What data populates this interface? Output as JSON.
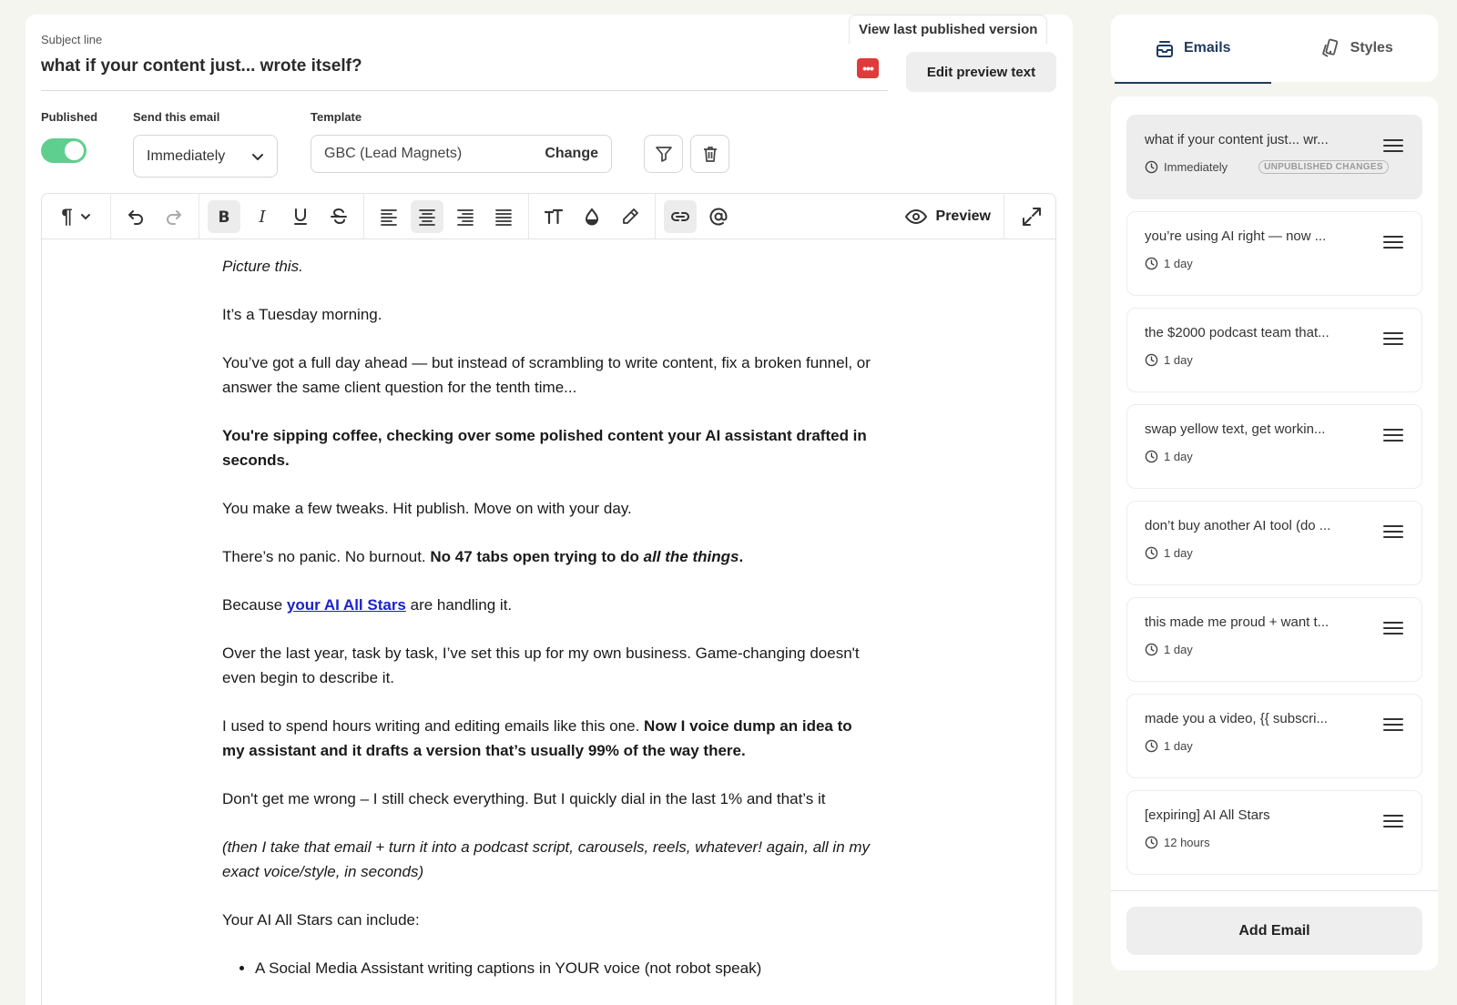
{
  "subject": {
    "label": "Subject line",
    "value": "what if your content just... wrote itself?",
    "view_last_published": "View last published version",
    "edit_preview_text": "Edit preview text",
    "ai_icon_glyph": "•••"
  },
  "settings": {
    "published_label": "Published",
    "published_on": true,
    "send_label": "Send this email",
    "send_value": "Immediately",
    "template_label": "Template",
    "template_value": "GBC (Lead Magnets)",
    "template_change": "Change"
  },
  "toolbar": {
    "paragraph_glyph": "¶",
    "preview_label": "Preview"
  },
  "content": {
    "p1": "Picture this.",
    "p2": "It’s a Tuesday morning.",
    "p3": "You’ve got a full day ahead — but instead of scrambling to write content, fix a broken funnel, or answer the same client question for the tenth time...",
    "p4": "You're sipping coffee, checking over some polished content your AI assistant drafted in seconds.",
    "p5": "You make a few tweaks. Hit publish. Move on with your day.",
    "p6a": "There’s no panic. No burnout. ",
    "p6b": "No 47 tabs open trying to do ",
    "p6c": "all the things",
    "p6d": ".",
    "p7a": "Because ",
    "p7link": "your AI All Stars",
    "p7b": " are handling it.",
    "p8": "Over the last year, task by task, I’ve set this up for my own business. Game-changing doesn't even begin to describe it.",
    "p9a": "I used to spend hours writing and editing emails like this one. ",
    "p9b": "Now I voice dump an idea to my assistant and it drafts a version that’s usually 99% of the way there.",
    "p10": "Don't get me wrong – I still check everything. But I quickly dial in the last 1% and that’s it",
    "p11": "(then I take that email + turn it into a podcast script, carousels, reels, whatever! again, all in my exact voice/style, in seconds)",
    "p12": "Your AI All Stars can include:",
    "li1": "A Social Media Assistant writing captions in YOUR voice (not robot speak)"
  },
  "sidebar": {
    "tabs": [
      {
        "label": "Emails",
        "icon": "inbox-icon",
        "active": true
      },
      {
        "label": "Styles",
        "icon": "palette-icon",
        "active": false
      }
    ],
    "emails": [
      {
        "title": "what if your content just... wr...",
        "timing": "Immediately",
        "badge": "UNPUBLISHED CHANGES"
      },
      {
        "title": "you’re using AI right — now ...",
        "timing": "1 day"
      },
      {
        "title": "the $2000 podcast team that...",
        "timing": "1 day"
      },
      {
        "title": "swap yellow text, get workin...",
        "timing": "1 day"
      },
      {
        "title": "don’t buy another AI tool (do ...",
        "timing": "1 day"
      },
      {
        "title": "this made me proud + want t...",
        "timing": "1 day"
      },
      {
        "title": "made you a video, {{ subscri...",
        "timing": "1 day"
      },
      {
        "title": "[expiring] AI All Stars",
        "timing": "12 hours"
      }
    ],
    "add_email": "Add Email"
  },
  "colors": {
    "toggle_on": "#5fcf8f",
    "link": "#1a23c9",
    "tab_active": "#1e3a5f",
    "ai_badge": "#e03a3a"
  }
}
